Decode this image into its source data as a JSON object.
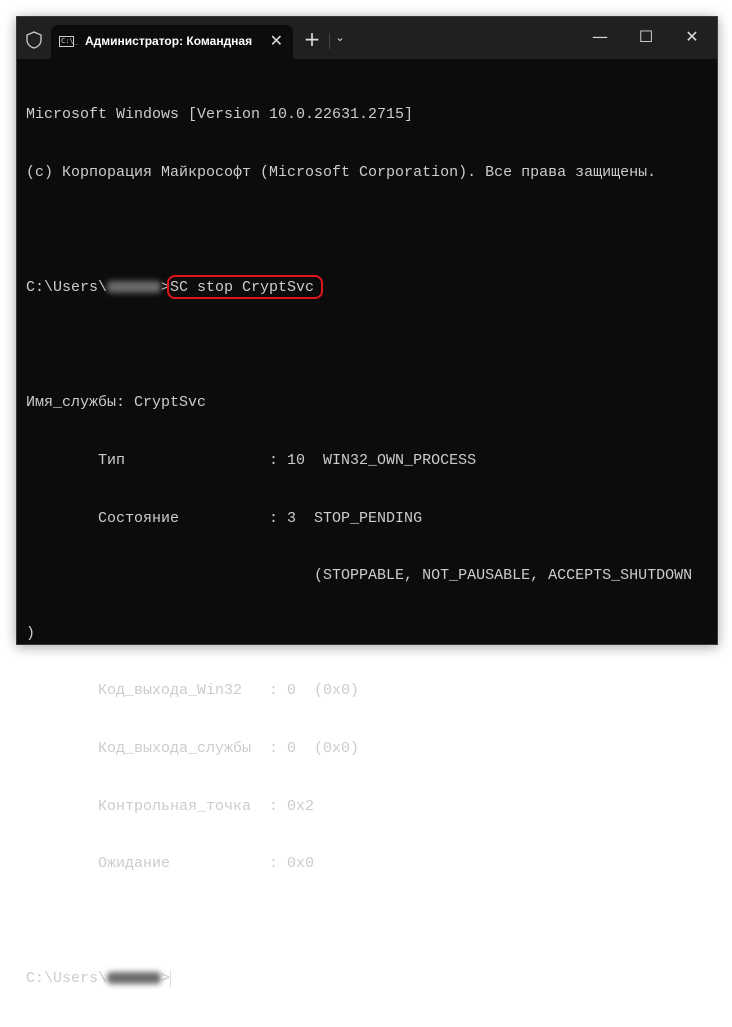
{
  "window": {
    "tab_title": "Администратор: Командная",
    "tab_icon_text": "C:\\_",
    "controls": {
      "new_tab": "+",
      "dropdown": "⌄",
      "minimize": "—",
      "maximize": "☐",
      "close": "✕",
      "tab_close": "✕"
    }
  },
  "terminal": {
    "header": [
      "Microsoft Windows [Version 10.0.22631.2715]",
      "(c) Корпорация Майкрософт (Microsoft Corporation). Все права защищены."
    ],
    "prompt_prefix": "C:\\Users\\",
    "prompt_suffix": ">",
    "command": "SC stop CryptSvc",
    "output": [
      "Имя_службы: CryptSvc",
      "        Тип                : 10  WIN32_OWN_PROCESS",
      "        Состояние          : 3  STOP_PENDING",
      "                                (STOPPABLE, NOT_PAUSABLE, ACCEPTS_SHUTDOWN",
      ")",
      "        Код_выхода_Win32   : 0  (0x0)",
      "        Код_выхода_службы  : 0  (0x0)",
      "        Контрольная_точка  : 0x2",
      "        Ожидание           : 0x0"
    ],
    "highlight_color": "#e0141c"
  }
}
